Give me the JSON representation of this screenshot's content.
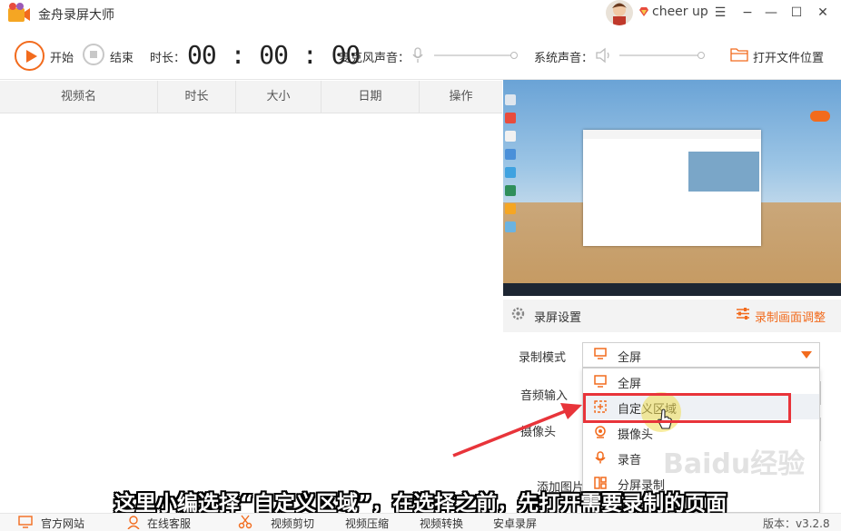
{
  "titlebar": {
    "app_title": "金舟录屏大师",
    "user_name": "cheer up",
    "min_icon": "minimize-icon",
    "max_icon": "maximize-icon",
    "close_icon": "close-icon",
    "menu_icon": "menu-icon"
  },
  "toolbar": {
    "start_label": "开始",
    "stop_label": "结束",
    "duration_label": "时长：",
    "duration_value": "00 : 00 : 00",
    "mic_label": "麦克风声音：",
    "system_label": "系统声音：",
    "open_folder_label": "打开文件位置"
  },
  "table": {
    "columns": [
      "视频名",
      "时长",
      "大小",
      "日期",
      "操作"
    ]
  },
  "settings": {
    "title": "录屏设置",
    "adjust_label": "录制画面调整",
    "mode_label": "录制模式",
    "mode_value": "全屏",
    "audio_label": "音频输入",
    "camera_label": "摄像头",
    "image_label": "添加图片",
    "dropdown": [
      {
        "label": "全屏",
        "icon": "monitor-icon"
      },
      {
        "label": "自定义区域",
        "icon": "region-select-icon"
      },
      {
        "label": "摄像头",
        "icon": "webcam-icon"
      },
      {
        "label": "录音",
        "icon": "microphone-icon"
      },
      {
        "label": "分屏录制",
        "icon": "split-screen-icon"
      }
    ]
  },
  "caption": "这里小编选择“自定义区域”，在选择之前，先打开需要录制的页面",
  "watermark": "Baidu经验",
  "bottombar": {
    "items": [
      "官方网站",
      "在线客服",
      "视频剪切",
      "视频压缩",
      "视频转换",
      "安卓录屏"
    ],
    "version": "版本：v3.2.8"
  },
  "colors": {
    "accent": "#f26b1d",
    "highlight_box": "#e8343a"
  }
}
